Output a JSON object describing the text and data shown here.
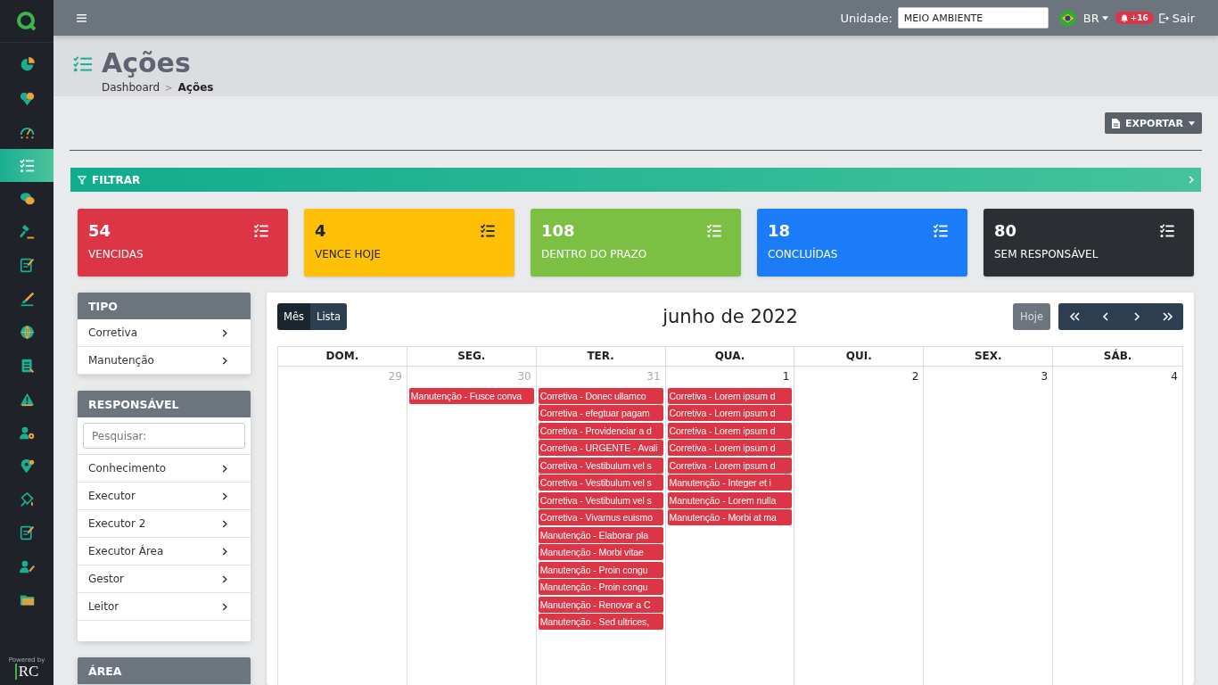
{
  "sidebar": {
    "items": [
      {
        "selected": false
      },
      {
        "selected": false
      },
      {
        "selected": false
      },
      {
        "selected": true
      },
      {
        "selected": false
      },
      {
        "selected": false
      },
      {
        "selected": false
      },
      {
        "selected": false
      },
      {
        "selected": false
      },
      {
        "selected": false
      },
      {
        "selected": false
      },
      {
        "selected": false
      },
      {
        "selected": false
      },
      {
        "selected": false
      },
      {
        "selected": false
      },
      {
        "selected": false
      },
      {
        "selected": false
      }
    ],
    "footer_small": "Powered by",
    "footer_brand": "RC"
  },
  "topbar": {
    "unit_label": "Unidade:",
    "unit_value": "MEIO AMBIENTE",
    "language": "BR",
    "notifications": "+16",
    "logout": "Sair"
  },
  "page": {
    "title": "Ações",
    "breadcrumb": [
      {
        "label": "Dashboard",
        "current": false
      },
      {
        "label": "Ações",
        "current": true
      }
    ],
    "breadcrumb_separator": ">"
  },
  "export_button": "EXPORTAR",
  "filter_bar": "FILTRAR",
  "stats": [
    {
      "value": "54",
      "label": "VENCIDAS",
      "color": "#dc3545"
    },
    {
      "value": "4",
      "label": "VENCE HOJE",
      "color": "#ffc107"
    },
    {
      "value": "108",
      "label": "DENTRO DO PRAZO",
      "color": "#7bc043"
    },
    {
      "value": "18",
      "label": "CONCLUÍDAS",
      "color": "#1a7cf7"
    },
    {
      "value": "80",
      "label": "SEM RESPONSÁVEL",
      "color": "#2b2f33"
    }
  ],
  "filters": [
    {
      "title": "TIPO",
      "items": [
        "Corretiva",
        "Manutenção"
      ]
    },
    {
      "title": "RESPONSÁVEL",
      "search": {
        "placeholder": "Pesquisar:"
      },
      "items": [
        "Conhecimento",
        "Executor",
        "Executor 2",
        "Executor Área",
        "Gestor",
        "Leitor"
      ]
    },
    {
      "title": "ÁREA"
    }
  ],
  "calendar": {
    "views": [
      {
        "label": "Mês",
        "selected": true
      },
      {
        "label": "Lista",
        "selected": false
      }
    ],
    "title": "junho de 2022",
    "today_button": {
      "label": "Hoje",
      "disabled": true
    },
    "weekdays": [
      "DOM.",
      "SEG.",
      "TER.",
      "QUA.",
      "QUI.",
      "SEX.",
      "SÁB."
    ],
    "days": [
      {
        "number": "29",
        "other_month": true
      },
      {
        "number": "30",
        "other_month": true,
        "events": [
          "Manutenção - Fusce conva"
        ]
      },
      {
        "number": "31",
        "other_month": true,
        "events": [
          "Corretiva - Donec ullamco",
          "Corretiva - efegtuar pagam",
          "Corretiva - Providenciar a d",
          "Corretiva - URGENTE - Avali",
          "Corretiva - Vestibulum vel s",
          "Corretiva - Vestibulum vel s",
          "Corretiva - Vestibulum vel s",
          "Corretiva - Vivamus euismo",
          "Manutenção - Elaborar pla",
          "Manutenção - Morbi vitae",
          "Manutenção - Proin congu",
          "Manutenção - Proin congu",
          "Manutenção - Renovar a C",
          "Manutenção - Sed ultrices,"
        ]
      },
      {
        "number": "1",
        "other_month": false,
        "events": [
          "Corretiva - Lorem ipsum d",
          "Corretiva - Lorem ipsum d",
          "Corretiva - Lorem ipsum d",
          "Corretiva - Lorem ipsum d",
          "Corretiva - Lorem ipsum d",
          "Manutenção - Integer et i",
          "Manutenção - Lorem nulla",
          "Manutenção - Morbi at ma"
        ]
      },
      {
        "number": "2",
        "other_month": false
      },
      {
        "number": "3",
        "other_month": false
      },
      {
        "number": "4",
        "other_month": false
      }
    ]
  }
}
